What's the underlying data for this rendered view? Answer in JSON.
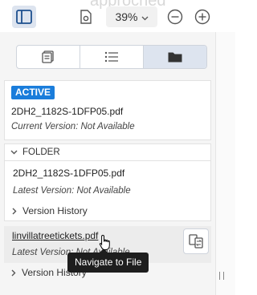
{
  "toolbar": {
    "ghost_title": "approched",
    "zoom_value": "39%",
    "icons": [
      "sidebar-toggle-icon",
      "page-settings-icon",
      "chevron-down-icon",
      "zoom-out-icon",
      "zoom-in-icon"
    ]
  },
  "panel_tabs": {
    "icons": [
      "thumbnails-icon",
      "list-icon",
      "folder-icon"
    ],
    "active_index": 2
  },
  "active_card": {
    "badge": "ACTIVE",
    "file_name": "2DH2_1182S-1DFP05.pdf",
    "version": "Current Version: Not Available"
  },
  "folder_section": {
    "header": "FOLDER",
    "items": [
      {
        "file_name": "2DH2_1182S-1DFP05.pdf",
        "version": "Latest Version: Not Available",
        "history": "Version History"
      },
      {
        "file_name": "linvillatreetickets.pdf",
        "version": "Latest Version: Not Available",
        "history": "Version History"
      }
    ]
  },
  "tooltip": "Navigate to File",
  "colors": {
    "accent": "#1a7ddb",
    "active_tab_bg": "#dde4ef",
    "tooltip_bg": "#1e1e1e"
  }
}
